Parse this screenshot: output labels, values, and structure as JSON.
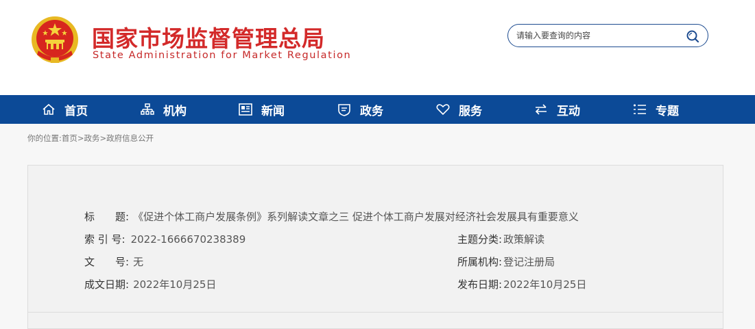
{
  "header": {
    "title_cn": "国家市场监督管理总局",
    "title_en": "State Administration for Market Regulation",
    "emblem_icon": "national-emblem-icon"
  },
  "search": {
    "placeholder": "请输入要查询的内容",
    "icon": "search-icon"
  },
  "nav": {
    "items": [
      {
        "label": "首页",
        "icon": "home-icon"
      },
      {
        "label": "机构",
        "icon": "org-chart-icon"
      },
      {
        "label": "新闻",
        "icon": "news-icon"
      },
      {
        "label": "政务",
        "icon": "shield-icon"
      },
      {
        "label": "服务",
        "icon": "heart-icon"
      },
      {
        "label": "互动",
        "icon": "exchange-icon"
      },
      {
        "label": "专题",
        "icon": "topic-list-icon"
      }
    ]
  },
  "breadcrumb": {
    "prefix": "你的位置:",
    "items": [
      "首页",
      "政务",
      "政府信息公开"
    ],
    "separator": ">"
  },
  "info": {
    "title_label": "标　　题:",
    "title_value": "《促进个体工商户发展条例》系列解读文章之三 促进个体工商户发展对经济社会发展具有重要意义",
    "index_label": "索 引 号:",
    "index_value": "2022-1666670238389",
    "category_label": "主题分类:",
    "category_value": "政策解读",
    "docno_label": "文　　号:",
    "docno_value": "无",
    "org_label": "所属机构:",
    "org_value": "登记注册局",
    "created_label": "成文日期:",
    "created_value": "2022年10月25日",
    "published_label": "发布日期:",
    "published_value": "2022年10月25日"
  },
  "colors": {
    "brand_red": "#d32a2a",
    "nav_blue": "#0c4a97",
    "search_border": "#1b4a8f"
  }
}
